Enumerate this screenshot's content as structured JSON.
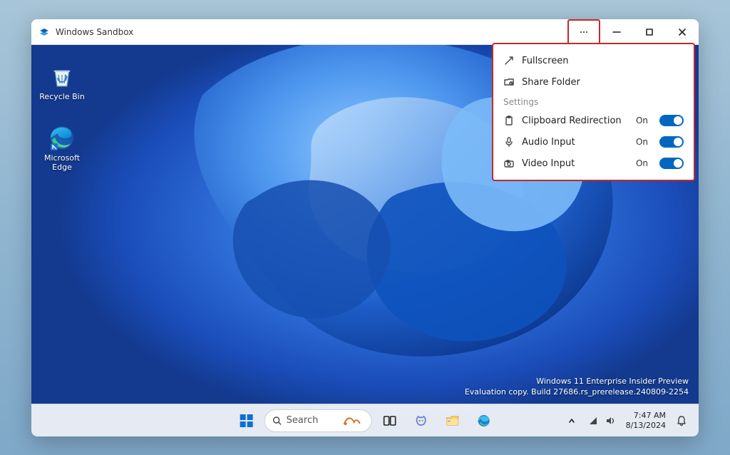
{
  "window": {
    "title": "Windows Sandbox"
  },
  "desktop": {
    "icons": [
      {
        "name": "recycle-bin",
        "label": "Recycle Bin"
      },
      {
        "name": "edge",
        "label": "Microsoft Edge"
      }
    ]
  },
  "menu": {
    "action_fullscreen": "Fullscreen",
    "action_share_folder": "Share Folder",
    "section_settings": "Settings",
    "items": [
      {
        "label": "Clipboard Redirection",
        "state": "On"
      },
      {
        "label": "Audio Input",
        "state": "On"
      },
      {
        "label": "Video Input",
        "state": "On"
      }
    ]
  },
  "watermark": {
    "line1": "Windows 11 Enterprise Insider Preview",
    "line2": "Evaluation copy. Build 27686.rs_prerelease.240809-2254"
  },
  "taskbar": {
    "search_placeholder": "Search",
    "clock_time": "7:47 AM",
    "clock_date": "8/13/2024"
  }
}
